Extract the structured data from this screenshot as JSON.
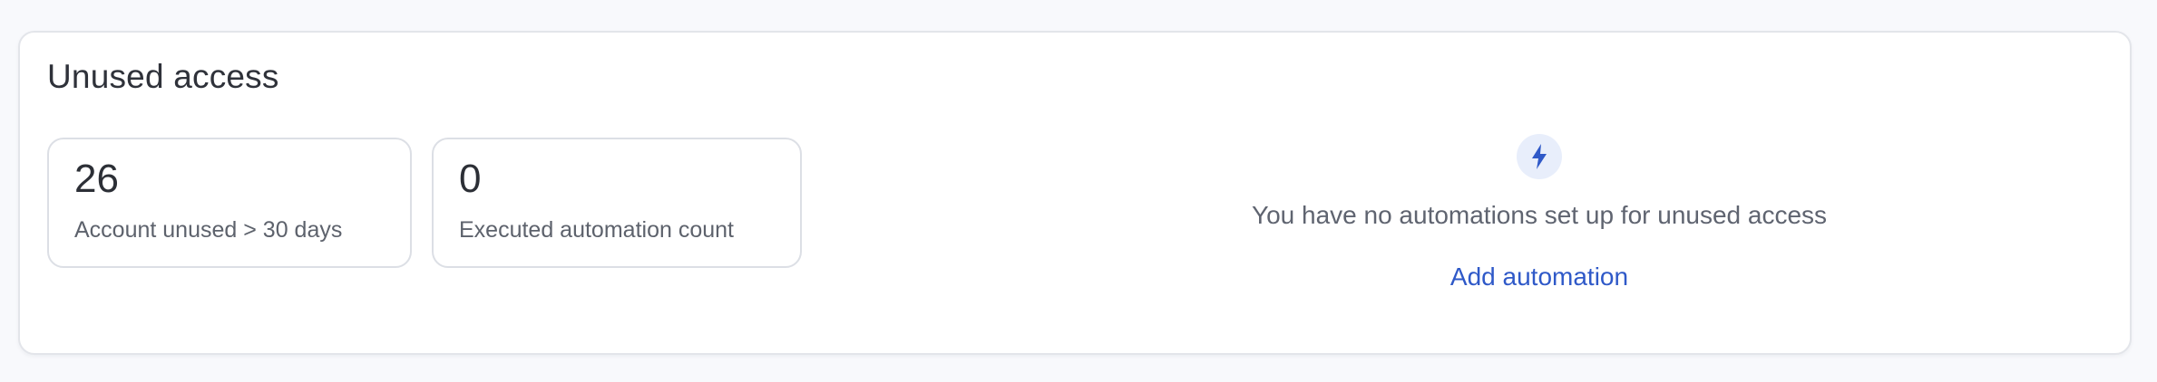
{
  "card": {
    "title": "Unused access"
  },
  "stats": [
    {
      "value": "26",
      "label": "Account unused > 30 days"
    },
    {
      "value": "0",
      "label": "Executed automation count"
    }
  ],
  "empty_state": {
    "icon": "lightning-bolt-icon",
    "message": "You have no automations set up for unused access",
    "action_label": "Add automation"
  },
  "colors": {
    "accent": "#2f59c8",
    "icon_badge_bg": "#e8eefb"
  }
}
